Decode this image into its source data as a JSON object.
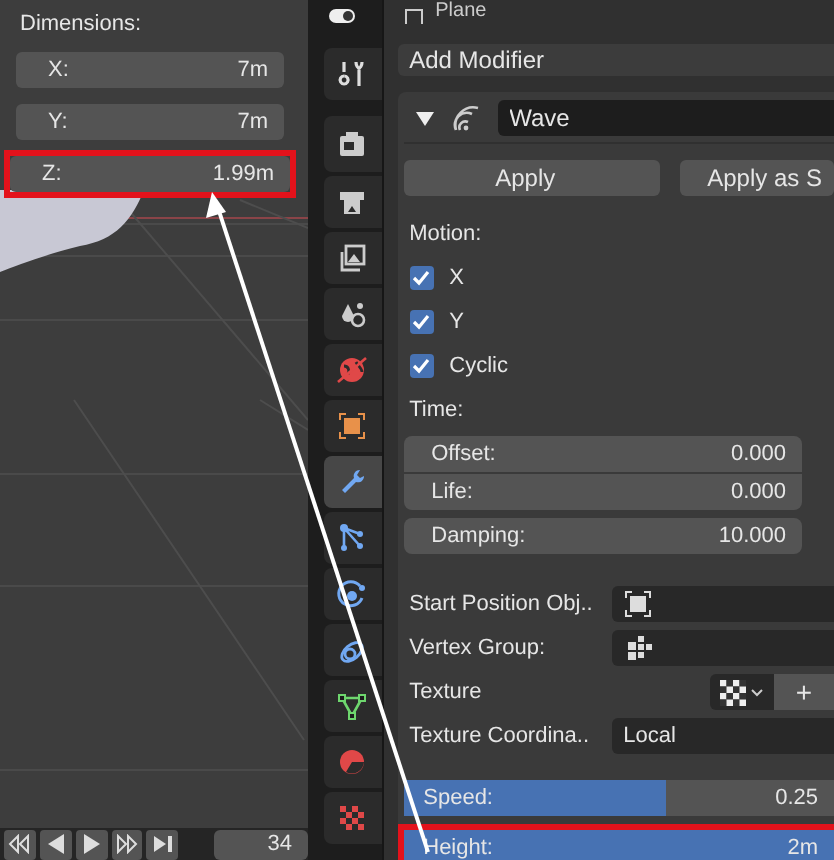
{
  "object_header": {
    "name": "Plane"
  },
  "dimensions": {
    "title": "Dimensions:",
    "fields": [
      {
        "label": "X:",
        "value": "7m",
        "highlighted": false
      },
      {
        "label": "Y:",
        "value": "7m",
        "highlighted": false
      },
      {
        "label": "Z:",
        "value": "1.99m",
        "highlighted": true
      }
    ]
  },
  "timeline": {
    "buttons": [
      {
        "kind": "prev_key"
      },
      {
        "kind": "play_reverse"
      },
      {
        "kind": "play"
      },
      {
        "kind": "next_key"
      },
      {
        "kind": "jump_end"
      }
    ],
    "frame": "34"
  },
  "property_tabs": [
    {
      "kind": "tool",
      "selected": false
    },
    {
      "kind": "render",
      "selected": false
    },
    {
      "kind": "output",
      "selected": false
    },
    {
      "kind": "view_layer",
      "selected": false
    },
    {
      "kind": "scene",
      "selected": false
    },
    {
      "kind": "world",
      "selected": false
    },
    {
      "kind": "object",
      "selected": false
    },
    {
      "kind": "modifier",
      "selected": true
    },
    {
      "kind": "particles",
      "selected": false
    },
    {
      "kind": "physics",
      "selected": false
    },
    {
      "kind": "constraints",
      "selected": false
    },
    {
      "kind": "data",
      "selected": false
    },
    {
      "kind": "material",
      "selected": false
    },
    {
      "kind": "texture",
      "selected": false
    }
  ],
  "modifier_panel": {
    "add_label": "Add Modifier",
    "modifier": {
      "name": "Wave",
      "expanded": true
    },
    "buttons": [
      "Apply",
      "Apply as S"
    ],
    "motion": {
      "title": "Motion:",
      "options": [
        {
          "label": "X",
          "checked": true
        },
        {
          "label": "Y",
          "checked": true
        },
        {
          "label": "Cyclic",
          "checked": true
        }
      ]
    },
    "time": {
      "title": "Time:",
      "groups": [
        {
          "fields": [
            {
              "label": "Offset:",
              "value": "0.000"
            },
            {
              "label": "Life:",
              "value": "0.000"
            }
          ]
        },
        {
          "fields": [
            {
              "label": "Damping:",
              "value": "10.000"
            }
          ]
        }
      ]
    },
    "properties": [
      {
        "kind": "object",
        "label": "Start Position Obj.."
      },
      {
        "kind": "vertex_group",
        "label": "Vertex Group:"
      },
      {
        "kind": "texture",
        "label": "Texture",
        "new_button": "+"
      },
      {
        "kind": "dropdown",
        "label": "Texture Coordina..",
        "value": "Local"
      }
    ],
    "sliders": [
      {
        "label": "Speed:",
        "value": "0.25",
        "level": 0.61,
        "highlighted": false
      },
      {
        "label": "Height:",
        "value": "2m",
        "level": 1,
        "highlighted": true
      }
    ]
  }
}
